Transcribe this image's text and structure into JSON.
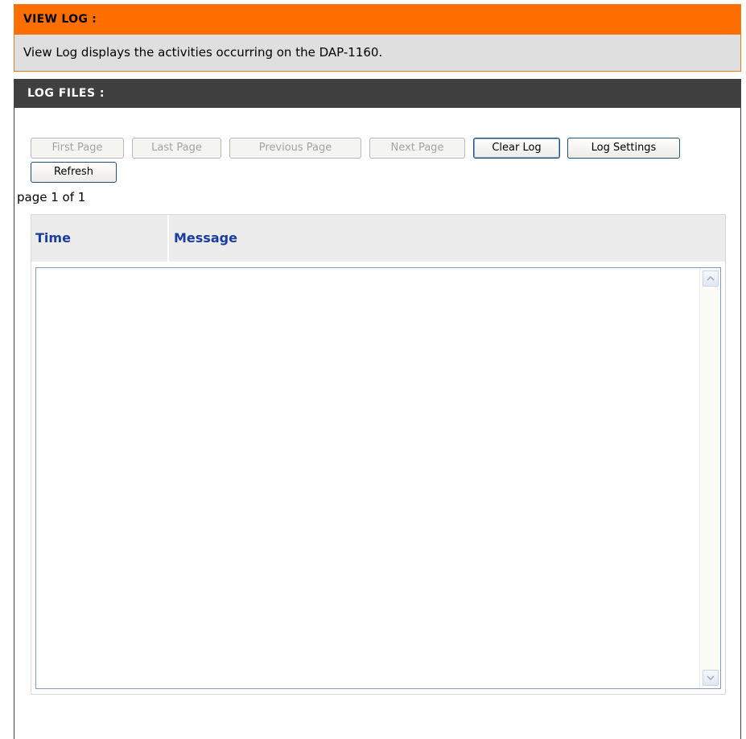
{
  "view_log": {
    "title": "VIEW LOG :",
    "description": "View Log displays the activities occurring on the DAP-1160."
  },
  "log_files": {
    "title": "LOG FILES :",
    "buttons": {
      "first_page": "First Page",
      "last_page": "Last Page",
      "previous_page": "Previous Page",
      "next_page": "Next Page",
      "clear_log": "Clear Log",
      "log_settings": "Log Settings",
      "refresh": "Refresh"
    },
    "page_indicator": "page 1 of 1",
    "table": {
      "columns": [
        "Time",
        "Message"
      ]
    },
    "log_content": "",
    "colors": {
      "view_log_header": "#ff6f00",
      "log_files_header": "#404040",
      "column_header_text": "#1a3ea0"
    }
  }
}
